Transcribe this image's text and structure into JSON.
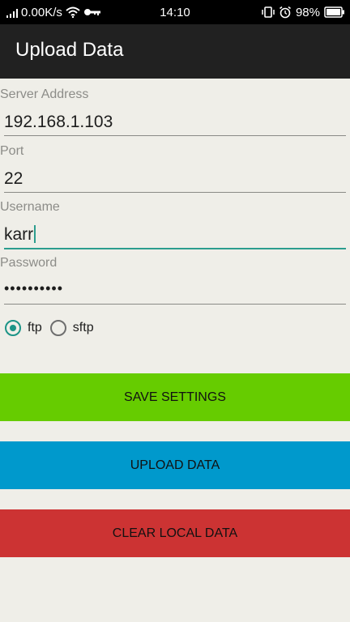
{
  "statusbar": {
    "net_speed": "0.00K/s",
    "time": "14:10",
    "battery": "98%"
  },
  "actionbar": {
    "title": "Upload Data"
  },
  "form": {
    "server_label": "Server Address",
    "server_value": "192.168.1.103",
    "port_label": "Port",
    "port_value": "22",
    "username_label": "Username",
    "username_value": "karr",
    "password_label": "Password",
    "password_value": "••••••••••"
  },
  "protocol": {
    "options": [
      "ftp",
      "sftp"
    ],
    "selected": "ftp"
  },
  "buttons": {
    "save": "SAVE SETTINGS",
    "upload": "UPLOAD DATA",
    "clear": "CLEAR LOCAL DATA"
  },
  "colors": {
    "save": "#66cc00",
    "upload": "#0099cc",
    "clear": "#cc3333",
    "accent": "#1c9487"
  },
  "icons": [
    "signal-icon",
    "wifi-icon",
    "vpn-key-icon",
    "vibrate-icon",
    "alarm-icon",
    "battery-icon"
  ]
}
